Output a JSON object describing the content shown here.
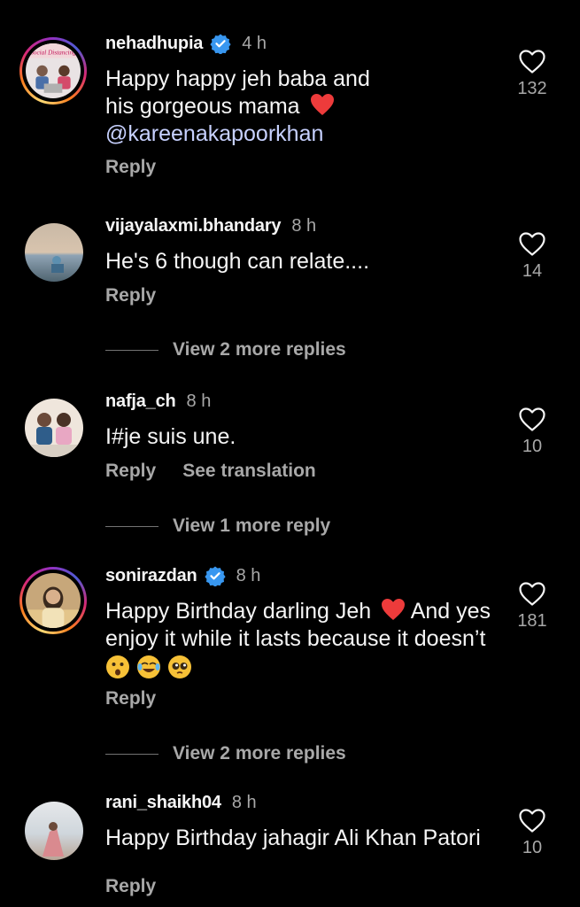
{
  "comments": [
    {
      "username": "nehadhupia",
      "verified": true,
      "time": "4 h",
      "text_line1": "Happy happy jeh baba and",
      "text_line2": "his gorgeous mama",
      "mention": "@kareenakapoorkhan",
      "actions": [
        "Reply"
      ],
      "likes": "132",
      "avatar_caption": "Social Distancing"
    },
    {
      "username": "vijayalaxmi.bhandary",
      "verified": false,
      "time": "8 h",
      "text": "He's 6 though can relate....",
      "actions": [
        "Reply"
      ],
      "likes": "14",
      "view_more": "View 2 more replies"
    },
    {
      "username": "nafja_ch",
      "verified": false,
      "time": "8 h",
      "text": "I#je suis une.",
      "actions": [
        "Reply",
        "See translation"
      ],
      "likes": "10",
      "view_more": "View 1 more reply"
    },
    {
      "username": "sonirazdan",
      "verified": true,
      "time": "8 h",
      "text_line1a": "Happy Birthday darling Jeh",
      "text_line1b": "And yes",
      "text_line2": "enjoy it while it lasts because it doesn’t",
      "actions": [
        "Reply"
      ],
      "likes": "181",
      "view_more": "View 2 more replies"
    },
    {
      "username": "rani_shaikh04",
      "verified": false,
      "time": "8 h",
      "text": "Happy Birthday jahagir Ali Khan Patori",
      "actions": [
        "Reply"
      ],
      "likes": "10"
    }
  ],
  "colors": {
    "background": "#000000",
    "text_primary": "#f5f5f5",
    "text_secondary": "#a8a8a8",
    "mention": "#c7d1ff",
    "verified_badge": "#3897f0",
    "heart_emoji": "#ed3b3b"
  },
  "icons": [
    "like-heart-icon",
    "verified-badge-icon",
    "red-heart-emoji",
    "astonished-emoji",
    "tears-of-joy-emoji",
    "pleading-emoji"
  ]
}
